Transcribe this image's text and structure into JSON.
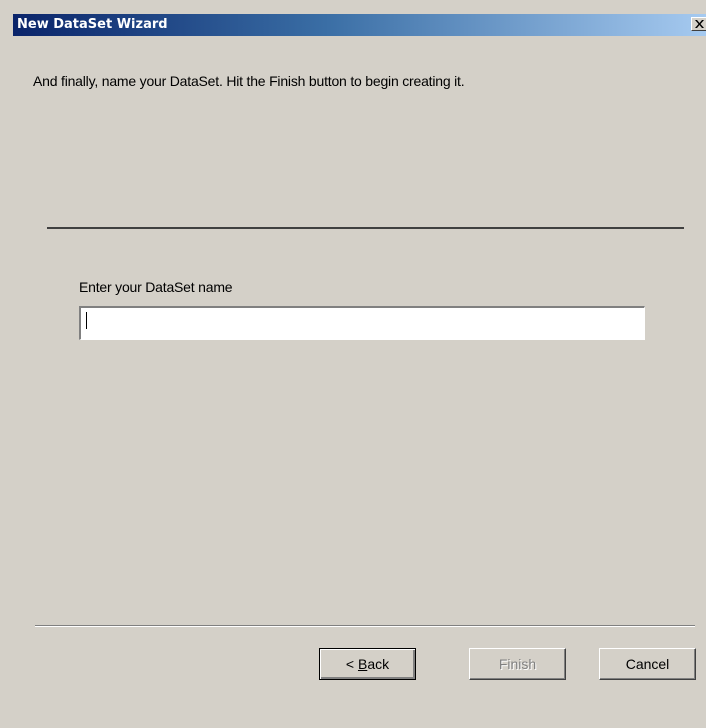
{
  "window": {
    "title": "New DataSet Wizard"
  },
  "content": {
    "intro_text": "And finally, name your DataSet.  Hit the Finish button to begin creating it.",
    "name_label": "Enter your DataSet name",
    "name_value": ""
  },
  "buttons": {
    "back_prefix": "< ",
    "back_mnemonic": "B",
    "back_rest": "ack",
    "finish_label": "Finish",
    "finish_enabled": false,
    "cancel_label": "Cancel"
  },
  "colors": {
    "title_bar_start": "#0a246a",
    "title_bar_end": "#a6caf0",
    "face": "#d4d0c8"
  },
  "icons": {
    "close": "close-icon"
  }
}
